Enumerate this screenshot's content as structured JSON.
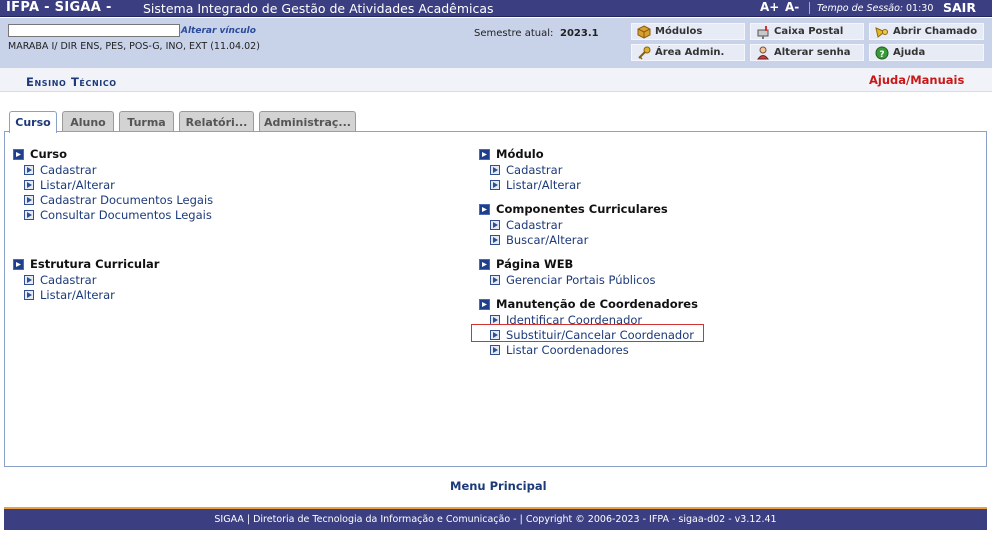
{
  "topbar": {
    "app_title": "IFPA - SIGAA -",
    "app_subtitle": "Sistema Integrado de Gestão de Atividades Acadêmicas",
    "font_increase": "A+",
    "font_decrease": "A-",
    "session_label": "Tempo de Sessão:",
    "session_time": "01:30",
    "logout": "SAIR"
  },
  "user_panel": {
    "user_name": "",
    "change_link": "Alterar vínculo",
    "unit": "MARABA I/ DIR ENS, PES, POS-G, INO, EXT (11.04.02)",
    "semester_label": "Semestre atual:",
    "semester_value": "2023.1"
  },
  "quick_buttons": [
    {
      "label": "Módulos",
      "icon": "cube-icon"
    },
    {
      "label": "Caixa Postal",
      "icon": "mailbox-icon"
    },
    {
      "label": "Abrir Chamado",
      "icon": "horn-icon"
    },
    {
      "label": "Área Admin.",
      "icon": "key-icon"
    },
    {
      "label": "Alterar senha",
      "icon": "user-icon"
    },
    {
      "label": "Ajuda",
      "icon": "help-icon"
    }
  ],
  "header": {
    "section_title": "Ensino Técnico",
    "help_link": "Ajuda/Manuais"
  },
  "tabs": [
    {
      "label": "Curso",
      "active": true
    },
    {
      "label": "Aluno",
      "active": false
    },
    {
      "label": "Turma",
      "active": false
    },
    {
      "label": "Relatóri...",
      "active": false
    },
    {
      "label": "Administraç...",
      "active": false
    }
  ],
  "menu": {
    "left": [
      {
        "title": "Curso",
        "items": [
          "Cadastrar",
          "Listar/Alterar",
          "Cadastrar Documentos Legais",
          "Consultar Documentos Legais"
        ]
      },
      {
        "title": "Estrutura Curricular",
        "items": [
          "Cadastrar",
          "Listar/Alterar"
        ]
      }
    ],
    "right": [
      {
        "title": "Módulo",
        "items": [
          "Cadastrar",
          "Listar/Alterar"
        ]
      },
      {
        "title": "Componentes Curriculares",
        "items": [
          "Cadastrar",
          "Buscar/Alterar"
        ]
      },
      {
        "title": "Página WEB",
        "items": [
          "Gerenciar Portais Públicos"
        ]
      },
      {
        "title": "Manutenção de Coordenadores",
        "items": [
          "Identificar Coordenador",
          "Substituir/Cancelar Coordenador",
          "Listar Coordenadores"
        ]
      }
    ]
  },
  "footer": {
    "menu_principal": "Menu Principal",
    "copyright": "SIGAA | Diretoria de Tecnologia da Informação e Comunicação - | Copyright © 2006-2023 - IFPA - sigaa-d02 - v3.12.41"
  },
  "colors": {
    "topbar": "#3b3f82",
    "panel": "#c8d3ea",
    "link": "#1c3a7a",
    "help": "#c81818",
    "highlight": "#d23333",
    "footer_accent": "#e8a040"
  }
}
